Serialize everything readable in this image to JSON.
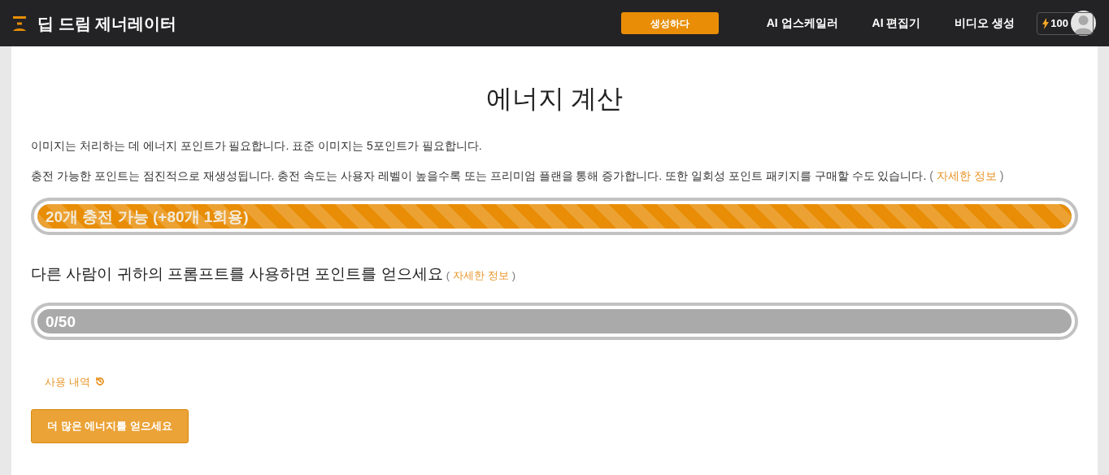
{
  "header": {
    "logo": "딥 드림 제너레이터",
    "nav": [
      {
        "label": "생성하다",
        "selected": true
      },
      {
        "label": "AI 업스케일러",
        "selected": false
      },
      {
        "label": "AI 편집기",
        "selected": false
      },
      {
        "label": "비디오 생성",
        "selected": false
      }
    ],
    "energy": "100"
  },
  "title": "에너지 계산",
  "paragraphs": [
    {
      "text": "이미지는 처리하는 데 에너지 포인트가 필요합니다. 표준 이미지는 5포인트가 필요합니다."
    },
    {
      "text": "충전 가능한 포인트는 점진적으로 재생성됩니다. 충전 속도는 사용자 레벨이 높을수록 또는 프리미엄 플랜을 통해 증가합니다. 또한 일회성 포인트 패키지를 구매할 수도 있습니다.",
      "link": {
        "open": "(",
        "text": "자세한 정보",
        "close": ")"
      }
    }
  ],
  "energy_bar": {
    "label": "20개 충전 가능 (+80개 1회용)",
    "level": 1
  },
  "referral": {
    "heading": "다른 사람이 귀하의 프롬프트를 사용하면 포인트를 얻으세요",
    "link": {
      "open": "(",
      "text": "자세한 정보",
      "close": ")"
    }
  },
  "referral_bar": {
    "label": "0/50",
    "level": 0
  },
  "history_link": "사용 내역",
  "cta_button": "더 많은 에너지를 얻으세요"
}
